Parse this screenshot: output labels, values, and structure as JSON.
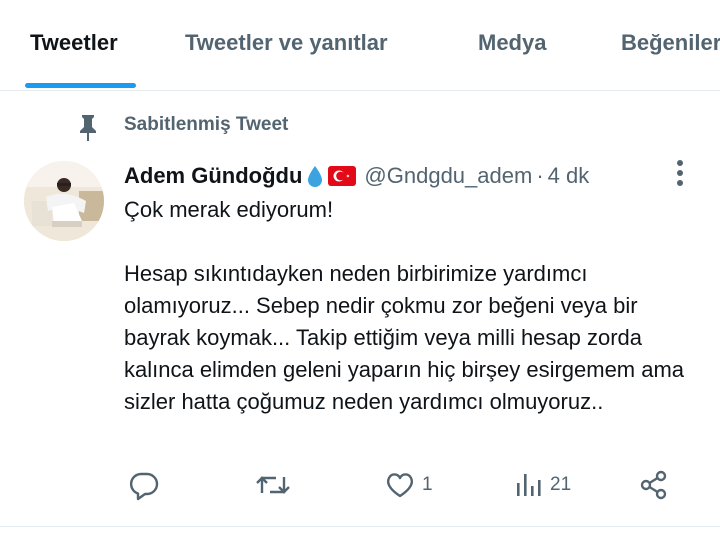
{
  "tabs": [
    {
      "label": "Tweetler",
      "active": true
    },
    {
      "label": "Tweetler ve yanıtlar",
      "active": false
    },
    {
      "label": "Medya",
      "active": false
    },
    {
      "label": "Beğeniler",
      "active": false
    }
  ],
  "pinned": {
    "label": "Sabitlenmiş Tweet"
  },
  "tweet": {
    "display_name": "Adem Gündoğdu",
    "handle": "@Gndgdu_adem",
    "separator": "·",
    "time": "4 dk",
    "text": "Çok merak ediyorum!\n\nHesap sıkıntıdayken neden birbirimize yardımcı olamıyoruz... Sebep nedir çokmu zor beğeni veya bir bayrak koymak... Takip ettiğim veya milli hesap zorda kalınca elimden geleni yaparın hiç birşey esirgemem ama sizler hatta çoğumuz neden yardımcı olmuyoruz..",
    "actions": {
      "reply_count": "",
      "retweet_count": "",
      "like_count": "1",
      "views_count": "21"
    }
  },
  "icons": [
    "pin-icon",
    "droplet-icon",
    "turkish-flag-icon",
    "more-icon",
    "reply-icon",
    "retweet-icon",
    "like-icon",
    "views-icon",
    "share-icon"
  ],
  "colors": {
    "accent": "#1d9bf0",
    "secondary_text": "#536471",
    "flag_red": "#e30a17"
  }
}
